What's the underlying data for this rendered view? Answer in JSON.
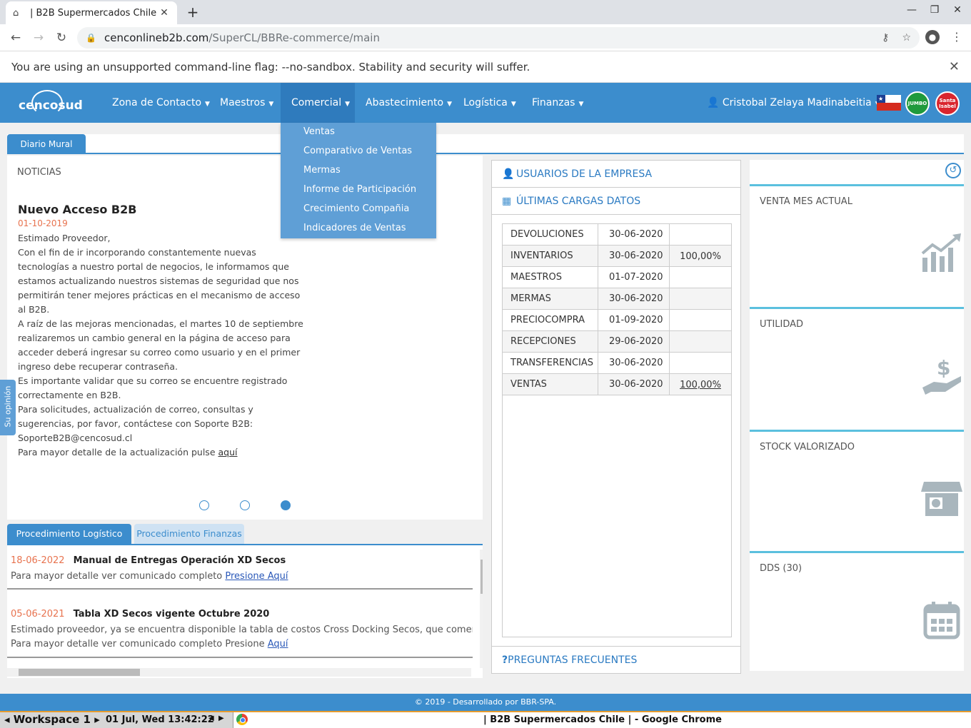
{
  "browser": {
    "tab_title": "| B2B Supermercados Chile | - Google Chrome",
    "tab_title_short": "| B2B Supermercados Chile",
    "url_host": "cenconlineb2b.com",
    "url_path": "/SuperCL/BBRe-commerce/main",
    "infobar_message": "You are using an unsupported command-line flag: --no-sandbox. Stability and security will suffer."
  },
  "nav": {
    "logo_text": "cencosud",
    "items": [
      {
        "label": "Zona de Contacto"
      },
      {
        "label": "Maestros"
      },
      {
        "label": "Comercial"
      },
      {
        "label": "Abastecimiento"
      },
      {
        "label": "Logística"
      },
      {
        "label": "Finanzas"
      }
    ],
    "user": "Cristobal Zelaya Madinabeitia",
    "jumbo": "JUMBO",
    "santa_isabel": "Santa Isabel"
  },
  "dropdown": {
    "items": [
      "Ventas",
      "Comparativo de Ventas",
      "Mermas",
      "Informe de Participación",
      "Crecimiento Compañia",
      "Indicadores de Ventas"
    ]
  },
  "mural": {
    "tab": "Diario Mural",
    "heading": "NOTICIAS",
    "news_title": "Nuevo Acceso B2B",
    "news_date": "01-10-2019",
    "paragraphs": [
      "Estimado Proveedor,",
      "Con el fin de ir incorporando constantemente nuevas tecnologías a nuestro portal de negocios, le informamos que estamos actualizando nuestros sistemas de seguridad que nos permitirán tener mejores prácticas en el mecanismo de acceso al B2B.",
      "A raíz de las mejoras mencionadas, el martes 10 de septiembre realizaremos un cambio general en la página de acceso para acceder deberá ingresar su correo como usuario y en el primer ingreso debe recuperar contraseña.",
      "Es importante validar que su correo se encuentre registrado correctamente en B2B.",
      "Para solicitudes, actualización de correo, consultas y sugerencias, por favor, contáctese con Soporte B2B: SoporteB2B@cencosud.cl"
    ],
    "last_line": "Para mayor detalle de la actualización pulse",
    "last_link": "aquí",
    "carousel_active": 3
  },
  "opinion": "Su opinión",
  "procedimientos": {
    "tab_active": "Procedimiento Logístico",
    "tab_inactive": "Procedimiento Finanzas",
    "items": [
      {
        "date": "18-06-2022",
        "title": "Manual de Entregas Operación XD Secos",
        "line1": "Para mayor detalle ver comunicado completo",
        "link1": "Presione Aquí"
      },
      {
        "date": "05-06-2021",
        "title": "Tabla XD Secos vigente Octubre 2020",
        "line1": "Estimado proveedor, ya se encuentra disponible la tabla de costos Cross Docking Secos, que comenzará a operar",
        "line2": "Para mayor detalle ver comunicado completo Presione",
        "link2": "Aquí"
      }
    ]
  },
  "middle": {
    "usuarios": "USUARIOS DE LA EMPRESA",
    "cargas": "ÚLTIMAS CARGAS DATOS",
    "faq": "PREGUNTAS FRECUENTES",
    "rows": [
      {
        "name": "DEVOLUCIONES",
        "date": "30-06-2020",
        "pct": ""
      },
      {
        "name": "INVENTARIOS",
        "date": "30-06-2020",
        "pct": "100,00%"
      },
      {
        "name": "MAESTROS",
        "date": "01-07-2020",
        "pct": ""
      },
      {
        "name": "MERMAS",
        "date": "30-06-2020",
        "pct": ""
      },
      {
        "name": "PRECIOCOMPRA",
        "date": "01-09-2020",
        "pct": ""
      },
      {
        "name": "RECEPCIONES",
        "date": "29-06-2020",
        "pct": ""
      },
      {
        "name": "TRANSFERENCIAS",
        "date": "30-06-2020",
        "pct": ""
      },
      {
        "name": "VENTAS",
        "date": "30-06-2020",
        "pct": "100,00%"
      }
    ]
  },
  "kpis": [
    {
      "label": "VENTA MES ACTUAL",
      "icon": "chart-growth-icon"
    },
    {
      "label": "UTILIDAD",
      "icon": "hand-dollar-icon"
    },
    {
      "label": "STOCK VALORIZADO",
      "icon": "store-icon"
    },
    {
      "label": "DDS (30)",
      "icon": "calendar-icon"
    }
  ],
  "footer": "© 2019 - Desarrollado por BBR-SPA.",
  "taskbar": {
    "workspace": "Workspace 1",
    "clock": "01 Jul, Wed 13:42:22"
  }
}
